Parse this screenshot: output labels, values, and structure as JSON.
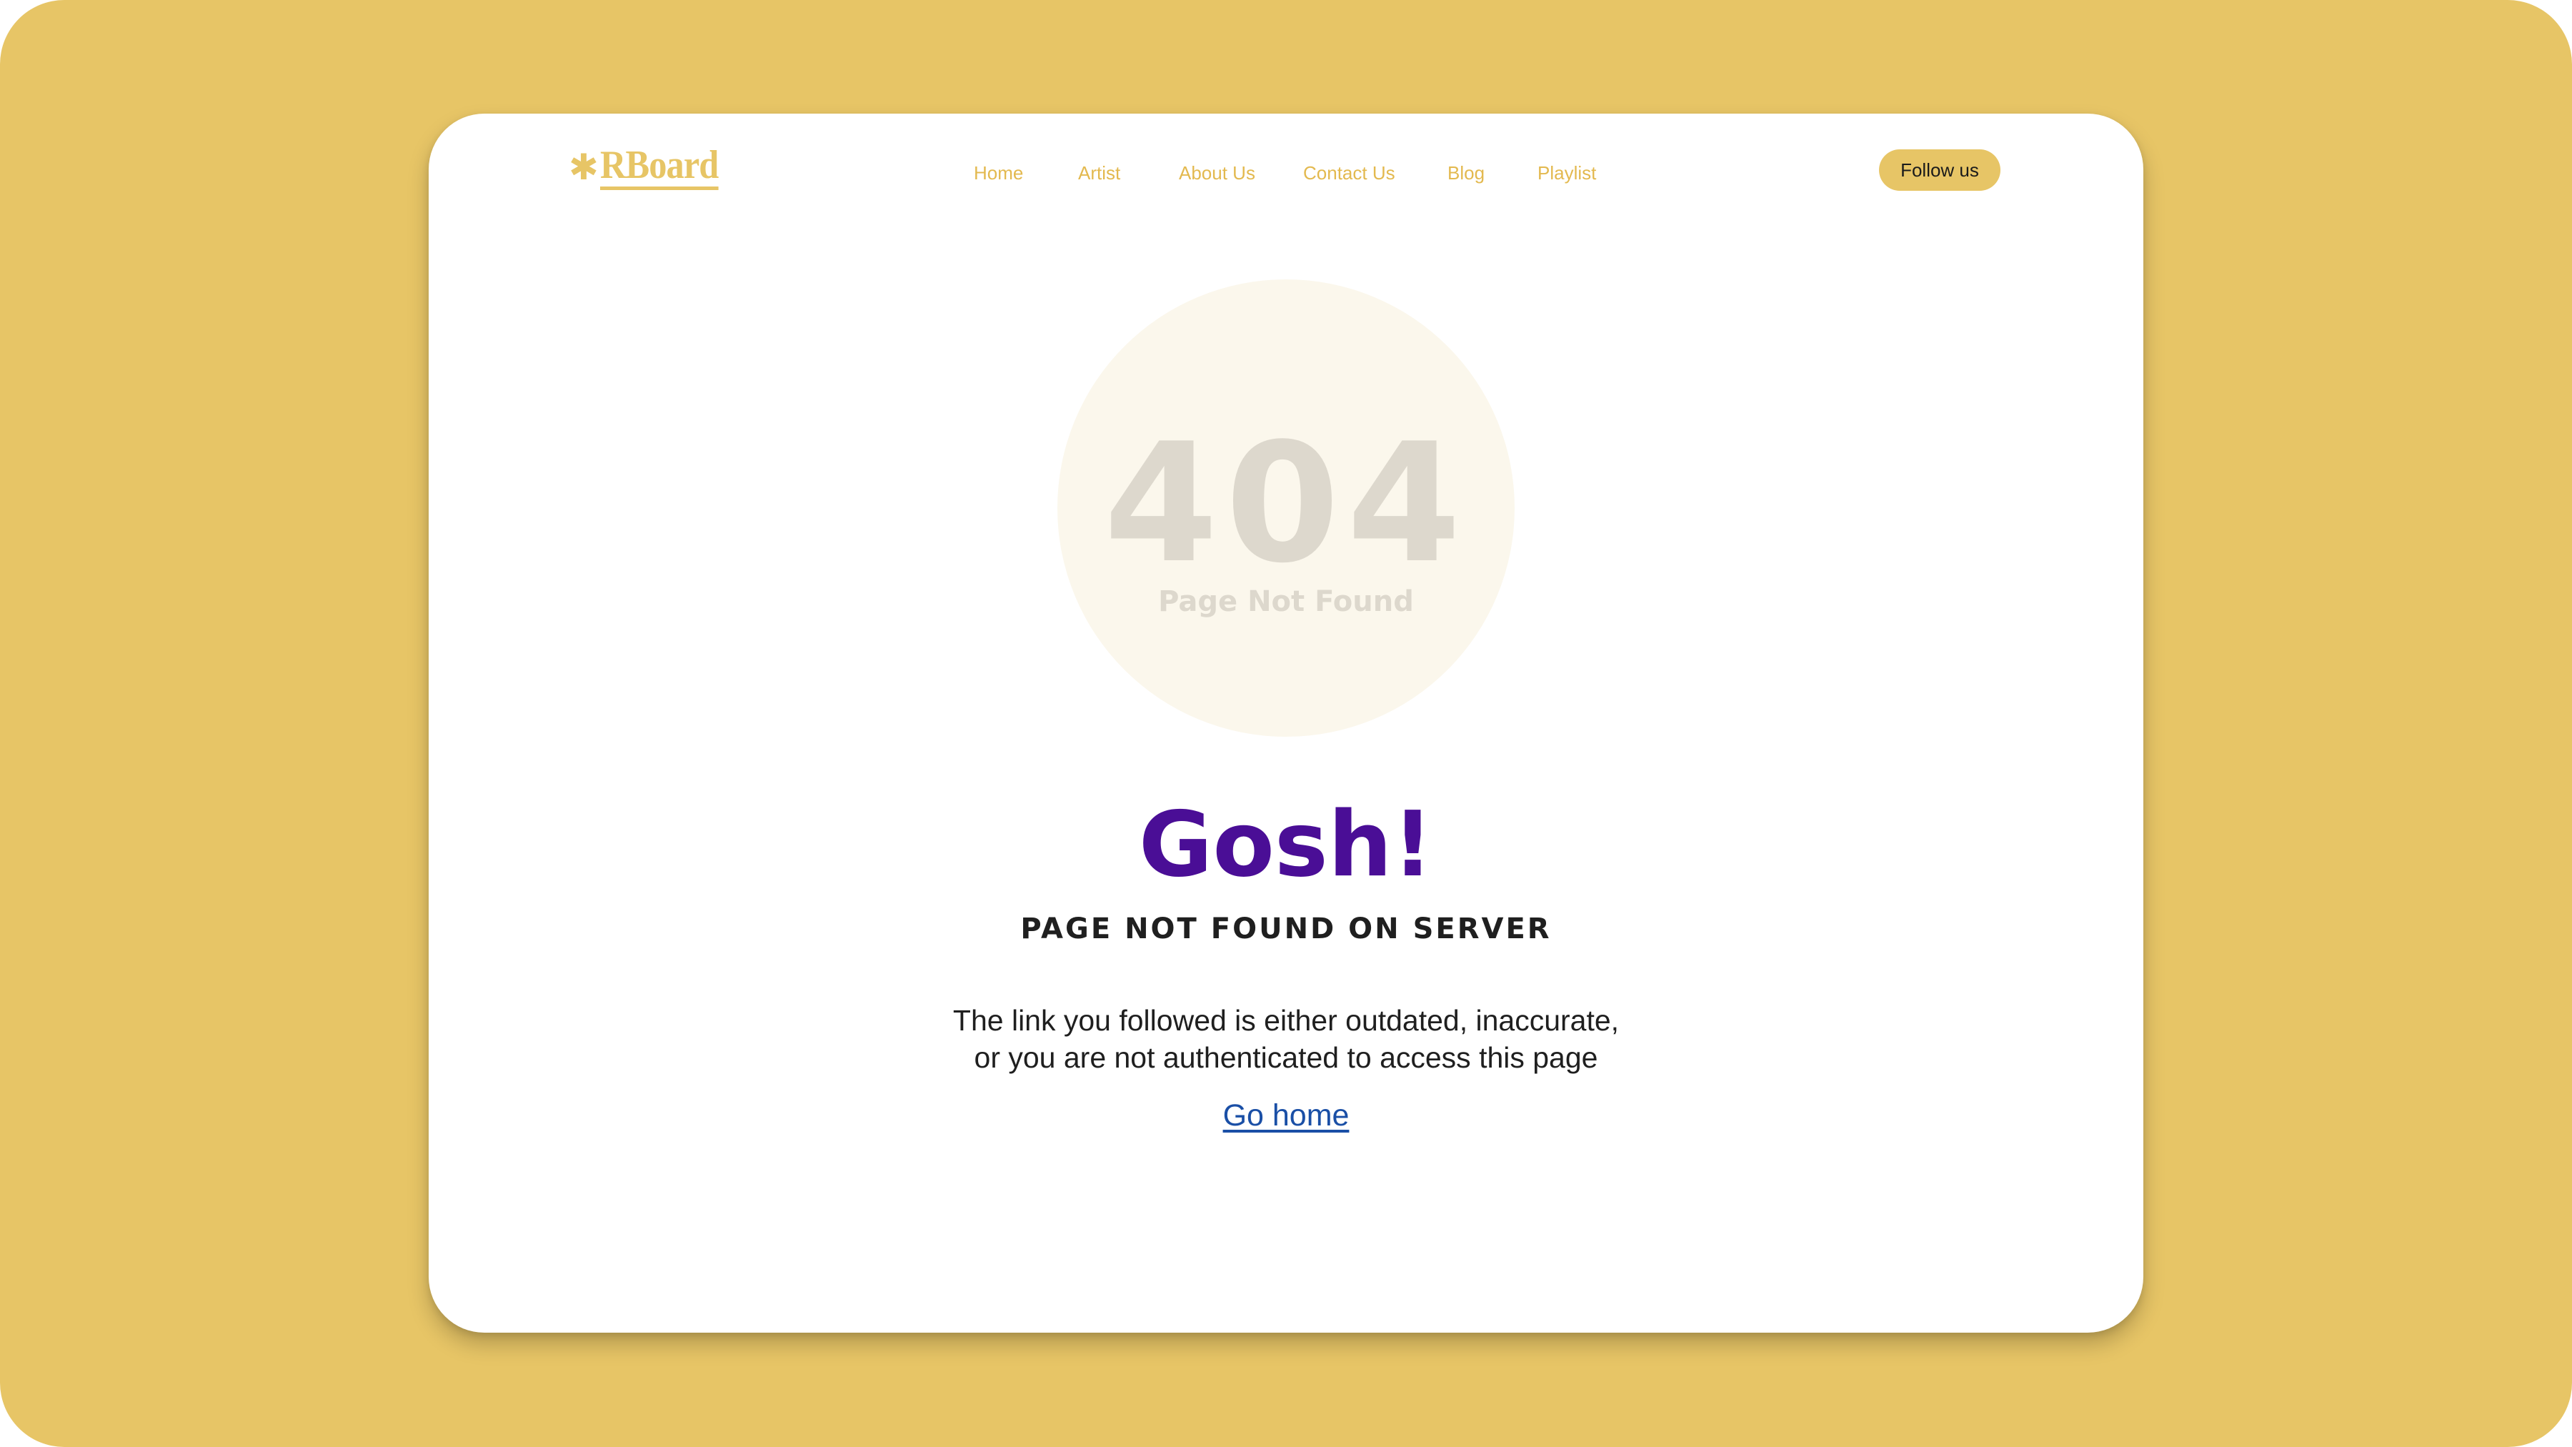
{
  "brand": {
    "logo_text": "RBoard",
    "logo_mark": "✱",
    "accent_color": "#E7C566",
    "headline_color": "#4A0E96",
    "link_color": "#1A4FA6"
  },
  "nav": {
    "items": [
      {
        "label": "Home"
      },
      {
        "label": "Artist"
      },
      {
        "label": "About Us"
      },
      {
        "label": "Contact Us"
      },
      {
        "label": "Blog"
      },
      {
        "label": "Playlist"
      }
    ],
    "follow_label": "Follow us"
  },
  "error": {
    "code": "404",
    "code_caption": "Page Not Found",
    "headline": "Gosh!",
    "subheadline": "PAGE NOT FOUND ON SERVER",
    "description_line1": "The link you followed is either outdated, inaccurate,",
    "description_line2": "or you are not authenticated to access this page",
    "home_link": "Go home"
  }
}
